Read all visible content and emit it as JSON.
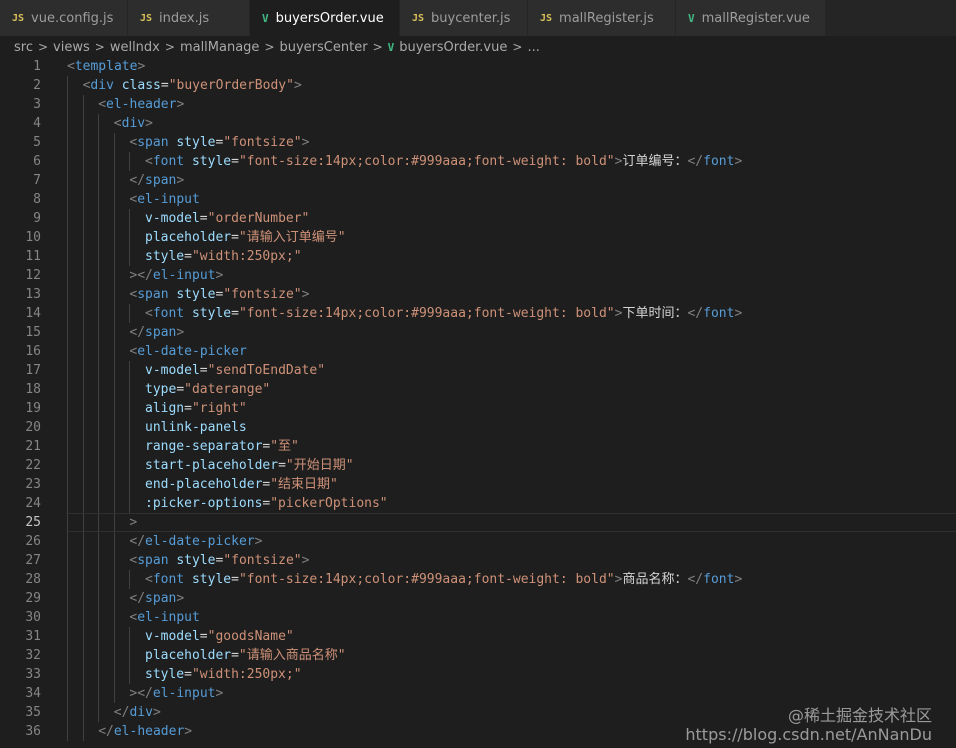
{
  "tabs": [
    {
      "label": "vue.config.js",
      "icon": "js-file-icon",
      "icon_text": "JS"
    },
    {
      "label": "index.js",
      "icon": "js-file-icon",
      "icon_text": "JS"
    },
    {
      "label": "buyersOrder.vue",
      "icon": "vue-file-icon",
      "icon_text": "V",
      "active": true,
      "modified": true
    },
    {
      "label": "buycenter.js",
      "icon": "js-file-icon",
      "icon_text": "JS"
    },
    {
      "label": "mallRegister.js",
      "icon": "js-file-icon",
      "icon_text": "JS"
    },
    {
      "label": "mallRegister.vue",
      "icon": "vue-file-icon",
      "icon_text": "V"
    }
  ],
  "breadcrumb": {
    "items": [
      "src",
      "views",
      "wellndx",
      "mallManage",
      "buyersCenter",
      "buyersOrder.vue",
      "..."
    ],
    "separator": ">"
  },
  "editor": {
    "current_line": 25,
    "lines": [
      {
        "n": "1",
        "indent": 0,
        "tokens": [
          [
            "br",
            "<"
          ],
          [
            "tag",
            "template"
          ],
          [
            "br",
            ">"
          ]
        ]
      },
      {
        "n": "2",
        "indent": 1,
        "tokens": [
          [
            "br",
            "<"
          ],
          [
            "tag",
            "div"
          ],
          [
            "op",
            " "
          ],
          [
            "at",
            "class"
          ],
          [
            "op",
            "="
          ],
          [
            "st",
            "\"buyerOrderBody\""
          ],
          [
            "br",
            ">"
          ]
        ]
      },
      {
        "n": "3",
        "indent": 2,
        "tokens": [
          [
            "br",
            "<"
          ],
          [
            "tag",
            "el-header"
          ],
          [
            "br",
            ">"
          ]
        ]
      },
      {
        "n": "4",
        "indent": 3,
        "tokens": [
          [
            "br",
            "<"
          ],
          [
            "tag",
            "div"
          ],
          [
            "br",
            ">"
          ]
        ]
      },
      {
        "n": "5",
        "indent": 4,
        "tokens": [
          [
            "br",
            "<"
          ],
          [
            "tag",
            "span"
          ],
          [
            "op",
            " "
          ],
          [
            "at",
            "style"
          ],
          [
            "op",
            "="
          ],
          [
            "st",
            "\"fontsize\""
          ],
          [
            "br",
            ">"
          ]
        ]
      },
      {
        "n": "6",
        "indent": 5,
        "tokens": [
          [
            "br",
            "<"
          ],
          [
            "tag",
            "font"
          ],
          [
            "op",
            " "
          ],
          [
            "at",
            "style"
          ],
          [
            "op",
            "="
          ],
          [
            "st",
            "\"font-size:14px;color:#999aaa;font-weight: bold\""
          ],
          [
            "br",
            ">"
          ],
          [
            "tx",
            "订单编号："
          ],
          [
            "br",
            "</"
          ],
          [
            "tag",
            "font"
          ],
          [
            "br",
            ">"
          ]
        ]
      },
      {
        "n": "7",
        "indent": 4,
        "tokens": [
          [
            "br",
            "</"
          ],
          [
            "tag",
            "span"
          ],
          [
            "br",
            ">"
          ]
        ]
      },
      {
        "n": "8",
        "indent": 4,
        "tokens": [
          [
            "br",
            "<"
          ],
          [
            "tag",
            "el-input"
          ]
        ]
      },
      {
        "n": "9",
        "indent": 5,
        "tokens": [
          [
            "at",
            "v-model"
          ],
          [
            "op",
            "="
          ],
          [
            "st",
            "\"orderNumber\""
          ]
        ]
      },
      {
        "n": "10",
        "indent": 5,
        "tokens": [
          [
            "at",
            "placeholder"
          ],
          [
            "op",
            "="
          ],
          [
            "st",
            "\"请输入订单编号\""
          ]
        ]
      },
      {
        "n": "11",
        "indent": 5,
        "tokens": [
          [
            "at",
            "style"
          ],
          [
            "op",
            "="
          ],
          [
            "st",
            "\"width:250px;\""
          ]
        ]
      },
      {
        "n": "12",
        "indent": 4,
        "tokens": [
          [
            "br",
            "></"
          ],
          [
            "tag",
            "el-input"
          ],
          [
            "br",
            ">"
          ]
        ]
      },
      {
        "n": "13",
        "indent": 4,
        "tokens": [
          [
            "br",
            "<"
          ],
          [
            "tag",
            "span"
          ],
          [
            "op",
            " "
          ],
          [
            "at",
            "style"
          ],
          [
            "op",
            "="
          ],
          [
            "st",
            "\"fontsize\""
          ],
          [
            "br",
            ">"
          ]
        ]
      },
      {
        "n": "14",
        "indent": 5,
        "tokens": [
          [
            "br",
            "<"
          ],
          [
            "tag",
            "font"
          ],
          [
            "op",
            " "
          ],
          [
            "at",
            "style"
          ],
          [
            "op",
            "="
          ],
          [
            "st",
            "\"font-size:14px;color:#999aaa;font-weight: bold\""
          ],
          [
            "br",
            ">"
          ],
          [
            "tx",
            "下单时间："
          ],
          [
            "br",
            "</"
          ],
          [
            "tag",
            "font"
          ],
          [
            "br",
            ">"
          ]
        ]
      },
      {
        "n": "15",
        "indent": 4,
        "tokens": [
          [
            "br",
            "</"
          ],
          [
            "tag",
            "span"
          ],
          [
            "br",
            ">"
          ]
        ]
      },
      {
        "n": "16",
        "indent": 4,
        "tokens": [
          [
            "br",
            "<"
          ],
          [
            "tag",
            "el-date-picker"
          ]
        ]
      },
      {
        "n": "17",
        "indent": 5,
        "tokens": [
          [
            "at",
            "v-model"
          ],
          [
            "op",
            "="
          ],
          [
            "st",
            "\"sendToEndDate\""
          ]
        ]
      },
      {
        "n": "18",
        "indent": 5,
        "tokens": [
          [
            "at",
            "type"
          ],
          [
            "op",
            "="
          ],
          [
            "st",
            "\"daterange\""
          ]
        ]
      },
      {
        "n": "19",
        "indent": 5,
        "tokens": [
          [
            "at",
            "align"
          ],
          [
            "op",
            "="
          ],
          [
            "st",
            "\"right\""
          ]
        ]
      },
      {
        "n": "20",
        "indent": 5,
        "tokens": [
          [
            "at",
            "unlink-panels"
          ]
        ]
      },
      {
        "n": "21",
        "indent": 5,
        "tokens": [
          [
            "at",
            "range-separator"
          ],
          [
            "op",
            "="
          ],
          [
            "st",
            "\"至\""
          ]
        ]
      },
      {
        "n": "22",
        "indent": 5,
        "tokens": [
          [
            "at",
            "start-placeholder"
          ],
          [
            "op",
            "="
          ],
          [
            "st",
            "\"开始日期\""
          ]
        ]
      },
      {
        "n": "23",
        "indent": 5,
        "tokens": [
          [
            "at",
            "end-placeholder"
          ],
          [
            "op",
            "="
          ],
          [
            "st",
            "\"结束日期\""
          ]
        ]
      },
      {
        "n": "24",
        "indent": 5,
        "tokens": [
          [
            "at",
            ":picker-options"
          ],
          [
            "op",
            "="
          ],
          [
            "st",
            "\"pickerOptions\""
          ]
        ]
      },
      {
        "n": "25",
        "indent": 4,
        "tokens": [
          [
            "br",
            ">"
          ]
        ]
      },
      {
        "n": "26",
        "indent": 4,
        "tokens": [
          [
            "br",
            "</"
          ],
          [
            "tag",
            "el-date-picker"
          ],
          [
            "br",
            ">"
          ]
        ]
      },
      {
        "n": "27",
        "indent": 4,
        "tokens": [
          [
            "br",
            "<"
          ],
          [
            "tag",
            "span"
          ],
          [
            "op",
            " "
          ],
          [
            "at",
            "style"
          ],
          [
            "op",
            "="
          ],
          [
            "st",
            "\"fontsize\""
          ],
          [
            "br",
            ">"
          ]
        ]
      },
      {
        "n": "28",
        "indent": 5,
        "tokens": [
          [
            "br",
            "<"
          ],
          [
            "tag",
            "font"
          ],
          [
            "op",
            " "
          ],
          [
            "at",
            "style"
          ],
          [
            "op",
            "="
          ],
          [
            "st",
            "\"font-size:14px;color:#999aaa;font-weight: bold\""
          ],
          [
            "br",
            ">"
          ],
          [
            "tx",
            "商品名称："
          ],
          [
            "br",
            "</"
          ],
          [
            "tag",
            "font"
          ],
          [
            "br",
            ">"
          ]
        ]
      },
      {
        "n": "29",
        "indent": 4,
        "tokens": [
          [
            "br",
            "</"
          ],
          [
            "tag",
            "span"
          ],
          [
            "br",
            ">"
          ]
        ]
      },
      {
        "n": "30",
        "indent": 4,
        "tokens": [
          [
            "br",
            "<"
          ],
          [
            "tag",
            "el-input"
          ]
        ]
      },
      {
        "n": "31",
        "indent": 5,
        "tokens": [
          [
            "at",
            "v-model"
          ],
          [
            "op",
            "="
          ],
          [
            "st",
            "\"goodsName\""
          ]
        ]
      },
      {
        "n": "32",
        "indent": 5,
        "tokens": [
          [
            "at",
            "placeholder"
          ],
          [
            "op",
            "="
          ],
          [
            "st",
            "\"请输入商品名称\""
          ]
        ]
      },
      {
        "n": "33",
        "indent": 5,
        "tokens": [
          [
            "at",
            "style"
          ],
          [
            "op",
            "="
          ],
          [
            "st",
            "\"width:250px;\""
          ]
        ]
      },
      {
        "n": "34",
        "indent": 4,
        "tokens": [
          [
            "br",
            "></"
          ],
          [
            "tag",
            "el-input"
          ],
          [
            "br",
            ">"
          ]
        ]
      },
      {
        "n": "35",
        "indent": 3,
        "tokens": [
          [
            "br",
            "</"
          ],
          [
            "tag",
            "div"
          ],
          [
            "br",
            ">"
          ]
        ]
      },
      {
        "n": "36",
        "indent": 2,
        "tokens": [
          [
            "br",
            "</"
          ],
          [
            "tag",
            "el-header"
          ],
          [
            "br",
            ">"
          ]
        ]
      }
    ]
  },
  "watermark": {
    "line1": "@稀土掘金技术社区",
    "line2": "https://blog.csdn.net/AnNanDu"
  }
}
